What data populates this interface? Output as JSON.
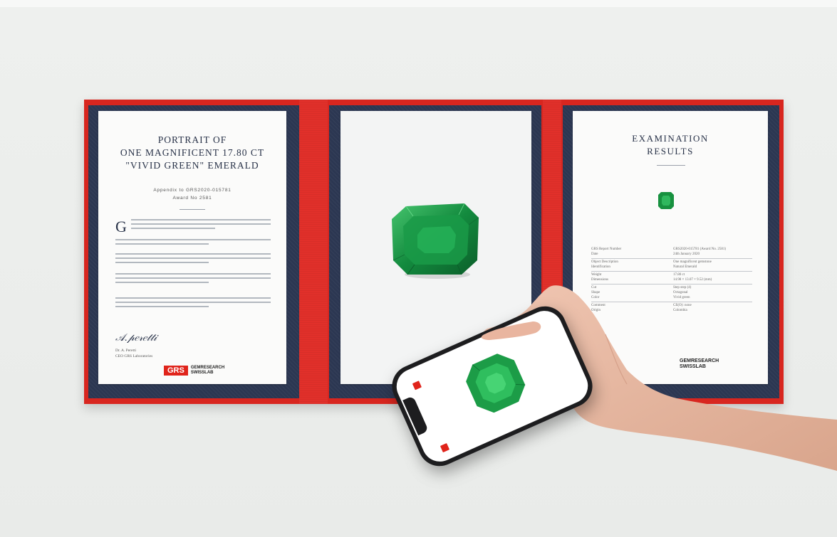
{
  "left_sheet": {
    "title_line1": "PORTRAIT OF",
    "title_line2": "ONE MAGNIFICENT 17.80 CT",
    "title_line3": "\"VIVID GREEN\" EMERALD",
    "appendix": "Appendix to GRS2020-015781",
    "award": "Award No 2581",
    "signature": "Dr. A. Peretti",
    "signer_name": "Dr. A. Peretti",
    "signer_title": "CEO GRS Laboratories",
    "logo_box": "GRS",
    "logo_line1": "GEMRESEARCH",
    "logo_line2": "SWISSLAB"
  },
  "right_sheet": {
    "title_line1": "EXAMINATION",
    "title_line2": "RESULTS",
    "rows": [
      {
        "k": "GRS Report Number",
        "v": "GRS2020-015781 (Award No. 2581)"
      },
      {
        "k": "Date",
        "v": "24th January 2020"
      },
      {
        "k": "Object Description",
        "v": "One magnificent gemstone"
      },
      {
        "k": "Identification",
        "v": "Natural Emerald"
      },
      {
        "k": "Weight",
        "v": "17.80 ct"
      },
      {
        "k": "Dimensions",
        "v": "14.98 × 13.07 × 9.52 (mm)"
      },
      {
        "k": "Cut",
        "v": "Step step (4)"
      },
      {
        "k": "Shape",
        "v": "Octagonal"
      },
      {
        "k": "Color",
        "v": "Vivid green"
      },
      {
        "k": "Comment",
        "v": "CE(O): none"
      },
      {
        "k": "Origin",
        "v": "Colombia"
      }
    ],
    "logo_line1": "GEMRESEARCH",
    "logo_line2": "SWISSLAB"
  },
  "colors": {
    "folder_red": "#d8261f",
    "panel_navy": "#2c3752",
    "emerald": "#1f9a4a",
    "skin": "#e9b8a2"
  }
}
